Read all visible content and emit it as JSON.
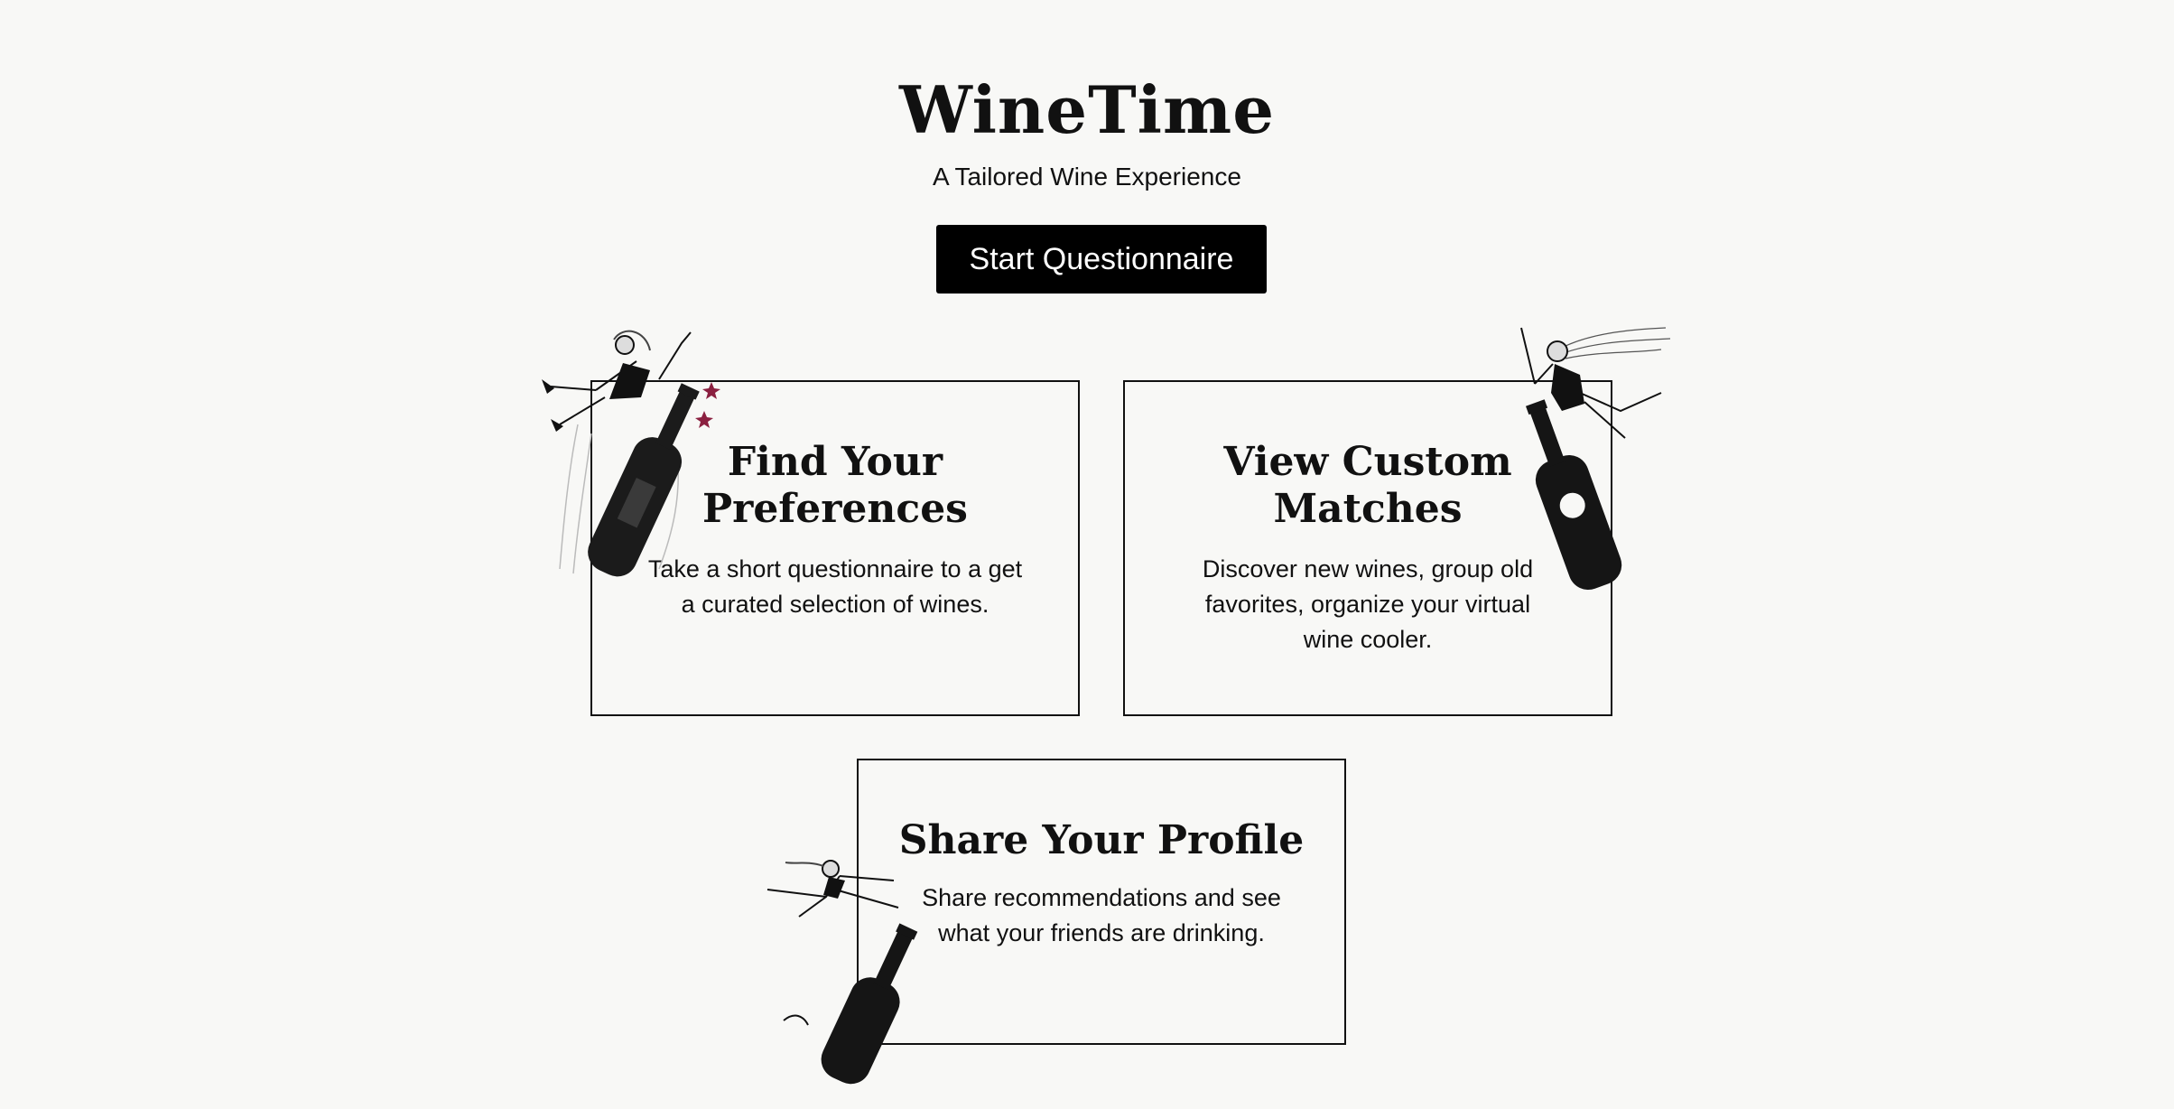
{
  "hero": {
    "title": "WineTime",
    "subtitle": "A Tailored Wine Experience",
    "cta_label": "Start Questionnaire"
  },
  "cards": [
    {
      "title": "Find Your Preferences",
      "description": "Take a short questionnaire to a get a curated selection of wines."
    },
    {
      "title": "View Custom Matches",
      "description": "Discover new wines, group old favorites, organize your virtual wine cooler."
    },
    {
      "title": "Share Your Profile",
      "description": "Share recommendations and see what your friends are drinking."
    }
  ],
  "illustrations": [
    {
      "name": "figure-riding-bottle-illustration"
    },
    {
      "name": "figure-flying-with-bottle-illustration"
    },
    {
      "name": "figure-leaping-over-bottle-illustration"
    }
  ],
  "colors": {
    "background": "#f8f8f6",
    "text": "#111111",
    "button": "#000000",
    "accent": "#8b2040"
  }
}
